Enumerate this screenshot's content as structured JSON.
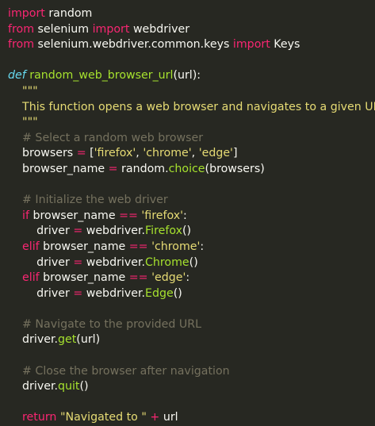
{
  "editor": {
    "language": "python",
    "colors": {
      "background": "#272822",
      "default": "#f8f8f2",
      "keyword": "#f92672",
      "definition": "#66d9ef",
      "function_name": "#a6e22e",
      "string": "#e6db74",
      "comment": "#75715e"
    },
    "lines": [
      [
        {
          "t": "kw",
          "v": "import"
        },
        {
          "t": "",
          "v": " random"
        }
      ],
      [
        {
          "t": "kw",
          "v": "from"
        },
        {
          "t": "",
          "v": " selenium "
        },
        {
          "t": "kw",
          "v": "import"
        },
        {
          "t": "",
          "v": " webdriver"
        }
      ],
      [
        {
          "t": "kw",
          "v": "from"
        },
        {
          "t": "",
          "v": " selenium.webdriver.common.keys "
        },
        {
          "t": "kw",
          "v": "import"
        },
        {
          "t": "",
          "v": " Keys"
        }
      ],
      [],
      [
        {
          "t": "def",
          "v": "def"
        },
        {
          "t": "",
          "v": " "
        },
        {
          "t": "fn",
          "v": "random_web_browser_url"
        },
        {
          "t": "",
          "v": "(url):"
        }
      ],
      [
        {
          "t": "str",
          "v": "    \"\"\""
        }
      ],
      [
        {
          "t": "str",
          "v": "    This function opens a web browser and navigates to a given URL."
        }
      ],
      [
        {
          "t": "str",
          "v": "    \"\"\""
        }
      ],
      [
        {
          "t": "cmt",
          "v": "    # Select a random web browser"
        }
      ],
      [
        {
          "t": "",
          "v": "    browsers "
        },
        {
          "t": "op",
          "v": "="
        },
        {
          "t": "",
          "v": " ["
        },
        {
          "t": "str",
          "v": "'firefox'"
        },
        {
          "t": "",
          "v": ", "
        },
        {
          "t": "str",
          "v": "'chrome'"
        },
        {
          "t": "",
          "v": ", "
        },
        {
          "t": "str",
          "v": "'edge'"
        },
        {
          "t": "",
          "v": "]"
        }
      ],
      [
        {
          "t": "",
          "v": "    browser_name "
        },
        {
          "t": "op",
          "v": "="
        },
        {
          "t": "",
          "v": " random."
        },
        {
          "t": "attr",
          "v": "choice"
        },
        {
          "t": "",
          "v": "(browsers)"
        }
      ],
      [],
      [
        {
          "t": "cmt",
          "v": "    # Initialize the web driver"
        }
      ],
      [
        {
          "t": "kw",
          "v": "    if"
        },
        {
          "t": "",
          "v": " browser_name "
        },
        {
          "t": "op",
          "v": "=="
        },
        {
          "t": "",
          "v": " "
        },
        {
          "t": "str",
          "v": "'firefox'"
        },
        {
          "t": "",
          "v": ":"
        }
      ],
      [
        {
          "t": "",
          "v": "        driver "
        },
        {
          "t": "op",
          "v": "="
        },
        {
          "t": "",
          "v": " webdriver."
        },
        {
          "t": "attr",
          "v": "Firefox"
        },
        {
          "t": "",
          "v": "()"
        }
      ],
      [
        {
          "t": "kw",
          "v": "    elif"
        },
        {
          "t": "",
          "v": " browser_name "
        },
        {
          "t": "op",
          "v": "=="
        },
        {
          "t": "",
          "v": " "
        },
        {
          "t": "str",
          "v": "'chrome'"
        },
        {
          "t": "",
          "v": ":"
        }
      ],
      [
        {
          "t": "",
          "v": "        driver "
        },
        {
          "t": "op",
          "v": "="
        },
        {
          "t": "",
          "v": " webdriver."
        },
        {
          "t": "attr",
          "v": "Chrome"
        },
        {
          "t": "",
          "v": "()"
        }
      ],
      [
        {
          "t": "kw",
          "v": "    elif"
        },
        {
          "t": "",
          "v": " browser_name "
        },
        {
          "t": "op",
          "v": "=="
        },
        {
          "t": "",
          "v": " "
        },
        {
          "t": "str",
          "v": "'edge'"
        },
        {
          "t": "",
          "v": ":"
        }
      ],
      [
        {
          "t": "",
          "v": "        driver "
        },
        {
          "t": "op",
          "v": "="
        },
        {
          "t": "",
          "v": " webdriver."
        },
        {
          "t": "attr",
          "v": "Edge"
        },
        {
          "t": "",
          "v": "()"
        }
      ],
      [],
      [
        {
          "t": "cmt",
          "v": "    # Navigate to the provided URL"
        }
      ],
      [
        {
          "t": "",
          "v": "    driver."
        },
        {
          "t": "attr",
          "v": "get"
        },
        {
          "t": "",
          "v": "(url)"
        }
      ],
      [],
      [
        {
          "t": "cmt",
          "v": "    # Close the browser after navigation"
        }
      ],
      [
        {
          "t": "",
          "v": "    driver."
        },
        {
          "t": "attr",
          "v": "quit"
        },
        {
          "t": "",
          "v": "()"
        }
      ],
      [],
      [
        {
          "t": "kw",
          "v": "    return"
        },
        {
          "t": "",
          "v": " "
        },
        {
          "t": "str",
          "v": "\"Navigated to \""
        },
        {
          "t": "",
          "v": " "
        },
        {
          "t": "op",
          "v": "+"
        },
        {
          "t": "",
          "v": " url"
        }
      ]
    ]
  }
}
